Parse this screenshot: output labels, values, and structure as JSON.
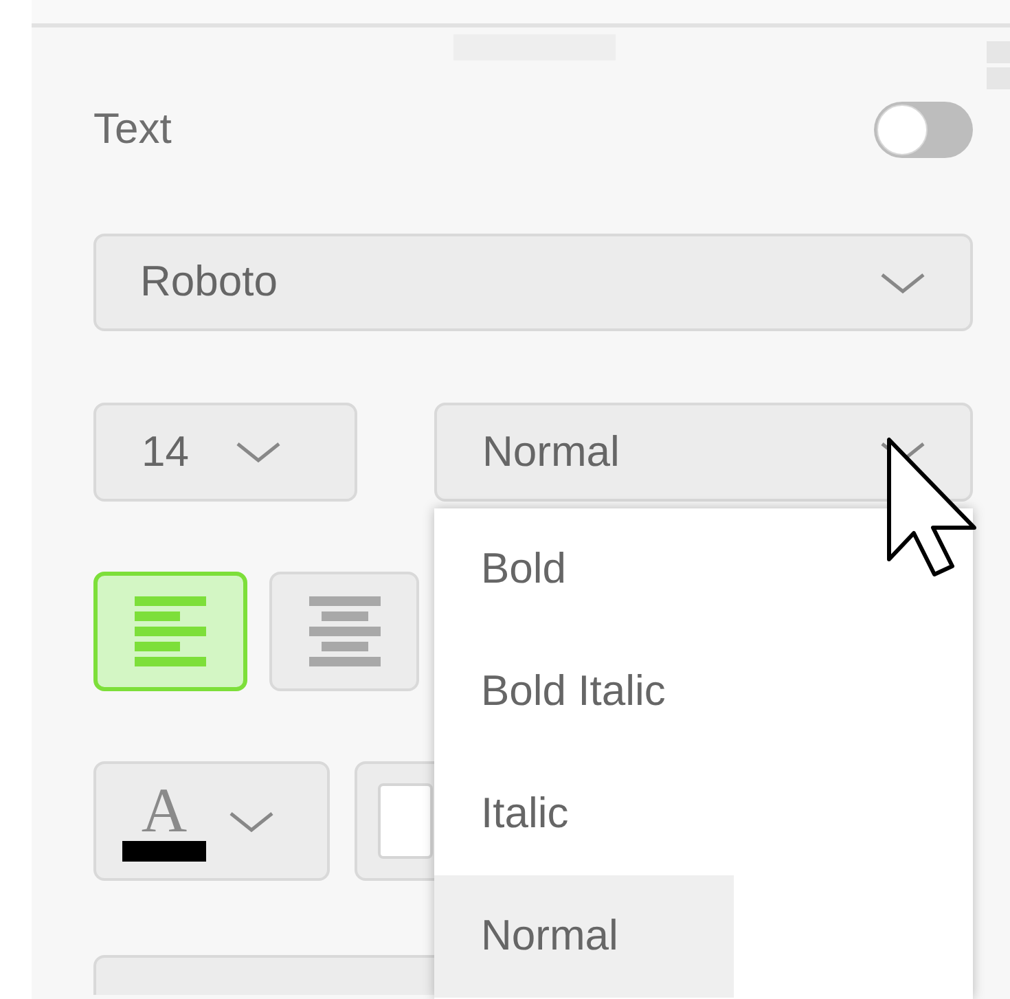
{
  "panel": {
    "title": "Text",
    "enabled": false
  },
  "font_family": {
    "value": "Roboto"
  },
  "font_size": {
    "value": "14"
  },
  "font_style": {
    "value": "Normal",
    "expanded": true,
    "options": [
      {
        "label": "Bold",
        "selected": false
      },
      {
        "label": "Bold Italic",
        "selected": false
      },
      {
        "label": "Italic",
        "selected": false
      },
      {
        "label": "Normal",
        "selected": true
      }
    ]
  },
  "alignment": [
    {
      "kind": "left",
      "selected": true
    },
    {
      "kind": "center",
      "selected": false
    }
  ],
  "text_color": {
    "glyph": "A"
  }
}
